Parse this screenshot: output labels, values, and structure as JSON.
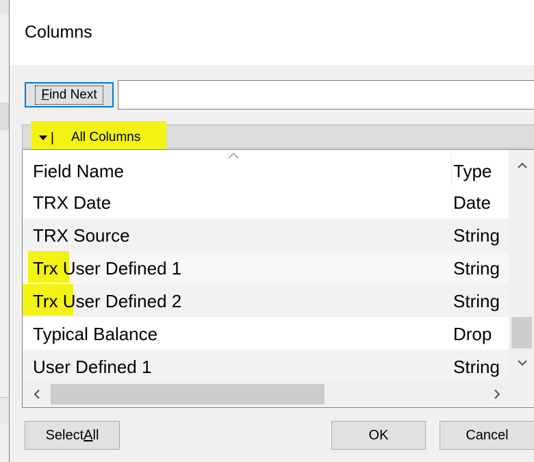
{
  "window": {
    "title": "Columns"
  },
  "find": {
    "button_label_prefix": "F",
    "button_label_rest": "ind Next",
    "input_value": ""
  },
  "columns_filter": {
    "separator": "|",
    "label": "All Columns"
  },
  "grid": {
    "columns": [
      "Field Name",
      "Type"
    ],
    "rows": [
      {
        "name": "TRX Date",
        "type": "Date"
      },
      {
        "name": "TRX Source",
        "type": "String"
      },
      {
        "name": "Trx User Defined 1",
        "type": "String"
      },
      {
        "name": "Trx User Defined 2",
        "type": "String"
      },
      {
        "name": "Typical Balance",
        "type": "Drop"
      },
      {
        "name": "User Defined 1",
        "type": "String"
      }
    ]
  },
  "buttons": {
    "select_all_prefix": "Select ",
    "select_all_accel": "A",
    "select_all_suffix": "ll",
    "ok": "OK",
    "cancel": "Cancel"
  },
  "colors": {
    "highlight": "#f2f213",
    "focus_border": "#0078d7",
    "window_edge": "#3a8ee6"
  },
  "icons": [
    "dropdown-caret-icon",
    "sort-ascending-icon",
    "scroll-up-icon",
    "scroll-down-icon",
    "scroll-left-icon",
    "scroll-right-icon"
  ]
}
